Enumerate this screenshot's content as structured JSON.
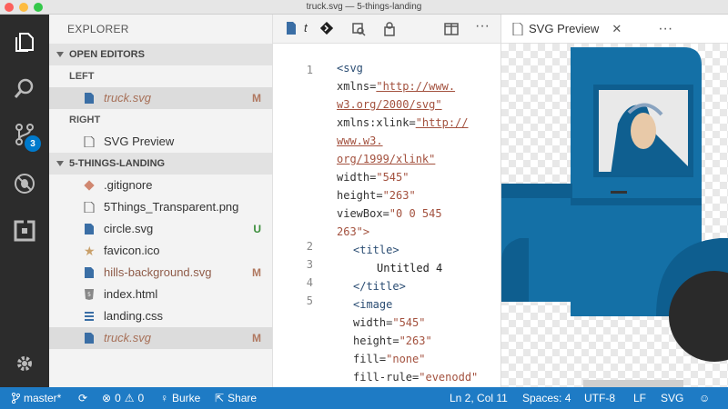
{
  "window": {
    "title": "truck.svg — 5-things-landing"
  },
  "activity_bar": {
    "items": [
      "files-icon",
      "search-icon",
      "source-control-icon",
      "debug-icon",
      "extensions-icon",
      "settings-gear-icon"
    ],
    "scm_badge": "3"
  },
  "sidebar": {
    "title": "EXPLORER",
    "open_editors": {
      "header": "OPEN EDITORS",
      "groups": [
        {
          "label": "LEFT",
          "items": [
            {
              "name": "truck.svg",
              "status": "M"
            }
          ]
        },
        {
          "label": "RIGHT",
          "items": [
            {
              "name": "SVG Preview",
              "status": ""
            }
          ]
        }
      ]
    },
    "folder": {
      "header": "5-THINGS-LANDING",
      "files": [
        {
          "name": ".gitignore",
          "status": ""
        },
        {
          "name": "5Things_Transparent.png",
          "status": ""
        },
        {
          "name": "circle.svg",
          "status": "U"
        },
        {
          "name": "favicon.ico",
          "status": ""
        },
        {
          "name": "hills-background.svg",
          "status": "M"
        },
        {
          "name": "index.html",
          "status": ""
        },
        {
          "name": "landing.css",
          "status": ""
        },
        {
          "name": "truck.svg",
          "status": "M"
        }
      ]
    }
  },
  "editor": {
    "tab_label": "t",
    "line_numbers": [
      "1",
      "2",
      "3",
      "4",
      "5"
    ],
    "code": {
      "l1": "<svg",
      "l2a": "xmlns=",
      "l2b": "\"http://www.",
      "l3": "w3.org/2000/svg\"",
      "l4a": "xmlns:xlink=",
      "l4b": "\"http://",
      "l5": "www.w3.",
      "l6": "org/1999/xlink\"",
      "l7a": "width=",
      "l7b": "\"545\"",
      "l8a": "height=",
      "l8b": "\"263\"",
      "l9a": "viewBox=",
      "l9b": "\"0 0 545",
      "l10": "263\">",
      "l11": "<title>",
      "l12": "Untitled 4",
      "l13": "</title>",
      "l14": "<image",
      "l15a": "width=",
      "l15b": "\"545\"",
      "l16a": "height=",
      "l16b": "\"263\"",
      "l17a": "fill=",
      "l17b": "\"none\"",
      "l18a": "fill-rule=",
      "l18b": "\"evenodd\""
    }
  },
  "preview": {
    "tab_label": "SVG Preview"
  },
  "status_bar": {
    "branch": "master*",
    "errors": "0",
    "warnings": "0",
    "user": "Burke",
    "share": "Share",
    "position": "Ln 2, Col 11",
    "spaces": "Spaces: 4",
    "encoding": "UTF-8",
    "eol": "LF",
    "language": "SVG"
  },
  "colors": {
    "accent": "#007acc",
    "status_bar": "#1e7bc5",
    "truck_blue": "#1470a6",
    "modified": "#b07860",
    "untracked": "#3b8e3b"
  }
}
